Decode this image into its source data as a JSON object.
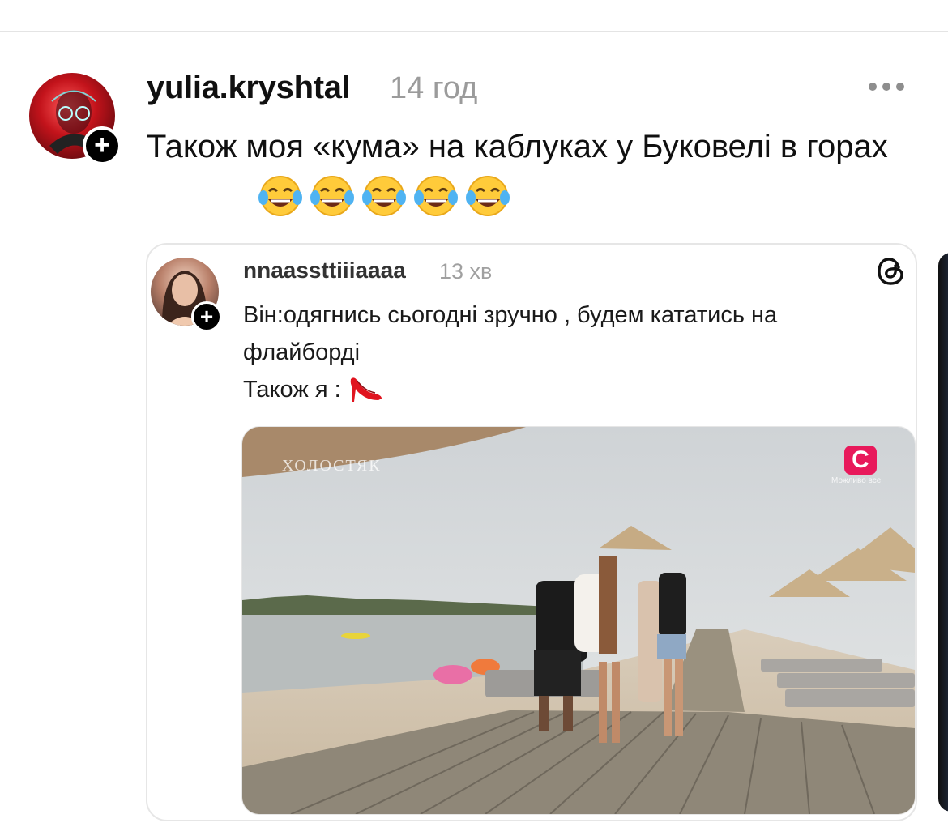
{
  "post": {
    "username": "yulia.kryshtal",
    "timestamp": "14 год",
    "text": "Також моя «кума» на каблуках у Буковелі в горах",
    "emoji": [
      "face-with-tears-of-joy",
      "face-with-tears-of-joy",
      "face-with-tears-of-joy",
      "face-with-tears-of-joy",
      "face-with-tears-of-joy"
    ],
    "follow_symbol": "+"
  },
  "quoted_post": {
    "username": "nnaassttiiiaaaa",
    "timestamp": "13 хв",
    "line1": "Він:одягнись сьогодні зручно , будем кататись на флайборді",
    "line2": "Також я :",
    "line2_emoji": "high-heeled-shoe",
    "follow_symbol": "+",
    "media": {
      "watermark": "ХОЛОСТЯК",
      "channel_logo": "С",
      "channel_caption": "Можливо все"
    }
  },
  "colors": {
    "text": "#101010",
    "muted": "#9b9b9b",
    "card_border": "#e6e6e6",
    "channel_logo": "#e8195b"
  }
}
